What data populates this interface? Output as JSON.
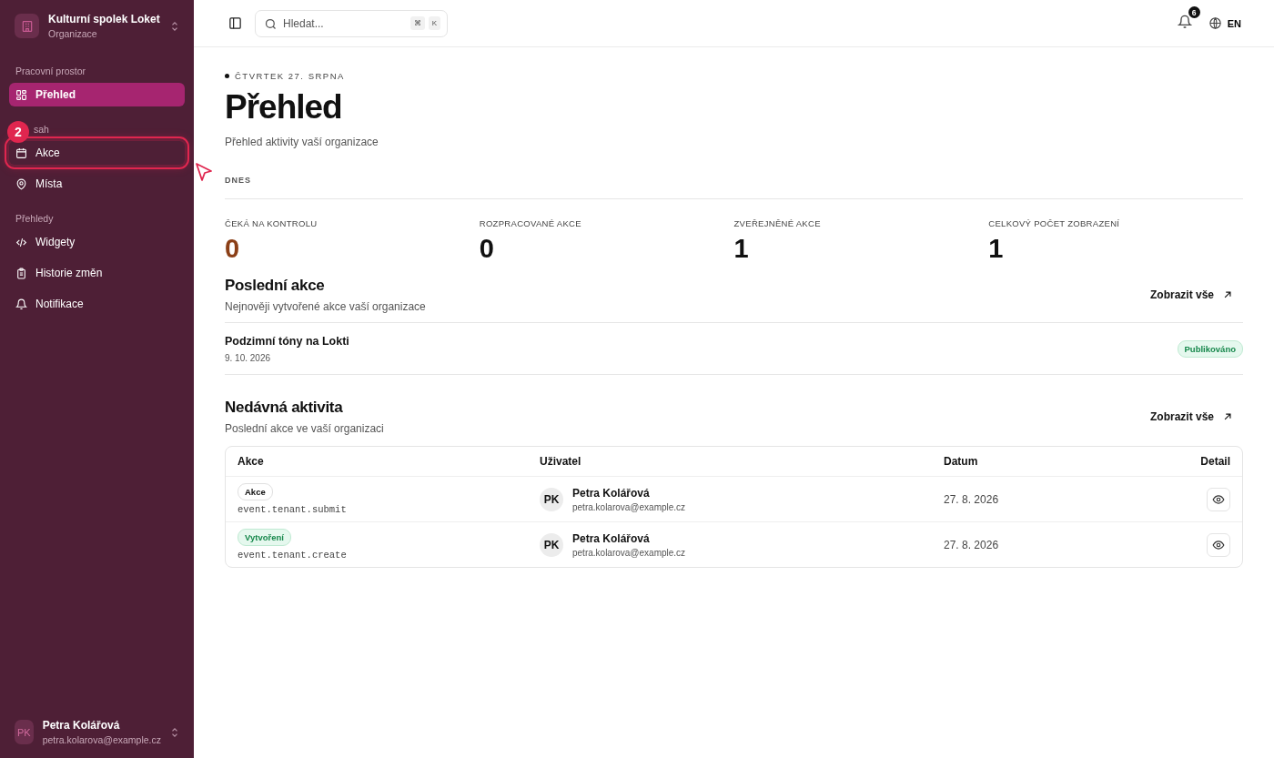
{
  "org": {
    "name": "Kulturní spolek Loket",
    "subtitle": "Organizace"
  },
  "sidebar": {
    "sections": [
      {
        "label": "Pracovní prostor",
        "items": [
          {
            "label": "Přehled",
            "selected": true
          }
        ]
      },
      {
        "label": "sah",
        "callout": "2",
        "items": [
          {
            "label": "Akce",
            "selected": false,
            "highlighted": true
          },
          {
            "label": "Místa",
            "selected": false,
            "highlighted": false
          }
        ]
      },
      {
        "label": "Přehledy",
        "items": [
          {
            "label": "Widgety",
            "selected": false
          },
          {
            "label": "Historie změn",
            "selected": false
          },
          {
            "label": "Notifikace",
            "selected": false
          }
        ]
      }
    ],
    "user": {
      "initials": "PK",
      "name": "Petra Kolářová",
      "email": "petra.kolarova@example.cz"
    }
  },
  "topbar": {
    "search": {
      "placeholder": "Hledat...",
      "keys": [
        "⌘",
        "K"
      ]
    },
    "notifications": "6",
    "language": "EN"
  },
  "page": {
    "date": "ČTVRTEK 27. SRPNA",
    "title": "Přehled",
    "subtitle": "Přehled aktivity vaší organizace",
    "section": "DNES"
  },
  "stats": [
    {
      "label": "ČEKÁ NA KONTROLU",
      "value": "0",
      "color": "#8b3f17"
    },
    {
      "label": "ROZPRACOVANÉ AKCE",
      "value": "0",
      "color": "#111111"
    },
    {
      "label": "ZVEŘEJNĚNÉ AKCE",
      "value": "1",
      "color": "#111111"
    },
    {
      "label": "CELKOVÝ POČET ZOBRAZENÍ",
      "value": "1",
      "color": "#111111"
    }
  ],
  "recent_events": {
    "title": "Poslední akce",
    "subtitle": "Nejnověji vytvořené akce vaší organizace",
    "link": "Zobrazit vše",
    "items": [
      {
        "name": "Podzimní tóny na Lokti",
        "date": "9. 10. 2026",
        "status": "Publikováno"
      }
    ]
  },
  "activity": {
    "title": "Nedávná aktivita",
    "subtitle": "Poslední akce ve vaší organizaci",
    "link": "Zobrazit vše",
    "columns": [
      "Akce",
      "Uživatel",
      "Datum",
      "Detail"
    ],
    "rows": [
      {
        "tag": "Akce",
        "kind": "neutral",
        "code": "event.tenant.submit",
        "initials": "PK",
        "user": "Petra Kolářová",
        "email": "petra.kolarova@example.cz",
        "date": "27. 8. 2026"
      },
      {
        "tag": "Vytvoření",
        "kind": "success",
        "code": "event.tenant.create",
        "initials": "PK",
        "user": "Petra Kolářová",
        "email": "petra.kolarova@example.cz",
        "date": "27. 8. 2026"
      }
    ]
  }
}
